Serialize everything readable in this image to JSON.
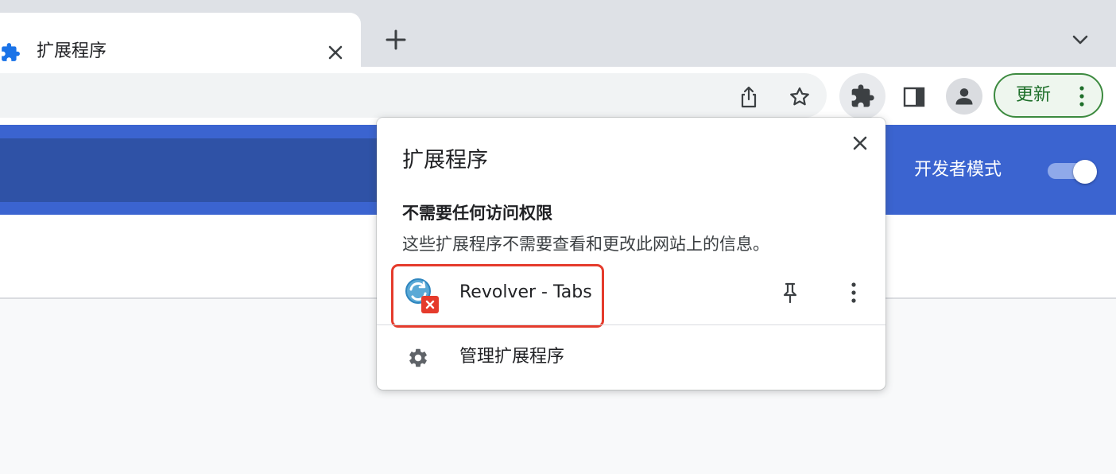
{
  "tab": {
    "title": "扩展程序",
    "icon": "puzzle-icon"
  },
  "toolbar": {
    "update_label": "更新"
  },
  "page": {
    "dev_mode_label": "开发者模式",
    "dev_mode_on": true
  },
  "popup": {
    "title": "扩展程序",
    "section_heading": "不需要任何访问权限",
    "section_desc": "这些扩展程序不需要查看和更改此网站上的信息。",
    "extensions": [
      {
        "name": "Revolver - Tabs",
        "icon": "revolver-tabs-icon"
      }
    ],
    "manage_label": "管理扩展程序"
  },
  "colors": {
    "accent_blue": "#3b64d0",
    "update_green": "#1e6f2a",
    "highlight_red": "#e53b2c"
  }
}
